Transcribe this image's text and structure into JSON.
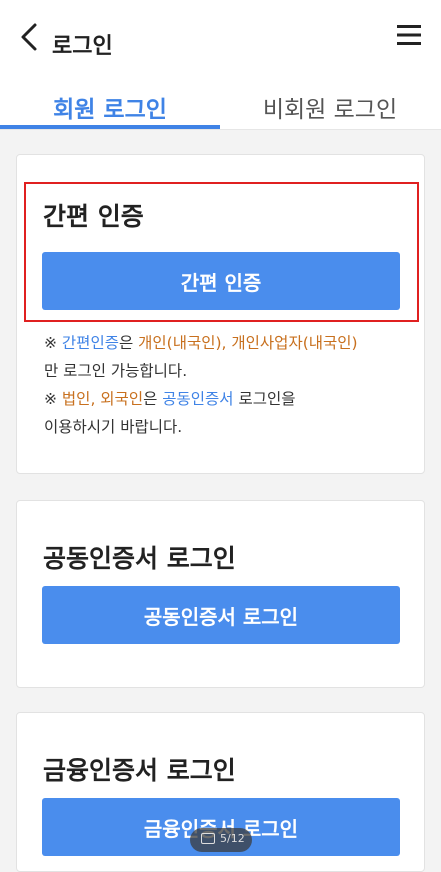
{
  "header": {
    "title": "로그인"
  },
  "tabs": [
    {
      "label": "회원 로그인"
    },
    {
      "label": "비회원 로그인"
    }
  ],
  "simple_auth": {
    "title": "간편 인증",
    "button": "간편 인증",
    "notice": {
      "mark1": "※ ",
      "simple": "간편인증",
      "eun": "은 ",
      "individuals": "개인(내국인), 개인사업자(내국인)",
      "rest1": "만 로그인 가능합니다.",
      "mark2": "※ ",
      "corp": "법인, 외국인",
      "eun2": "은 ",
      "joint": "공동인증서",
      "rest2": " 로그인을",
      "rest3": "이용하시기 바랍니다."
    }
  },
  "joint_cert": {
    "title": "공동인증서 로그인",
    "button": "공동인증서 로그인"
  },
  "financial_cert": {
    "title": "금융인증서 로그인",
    "button": "금융인증서 로그인"
  },
  "pager": {
    "text": "5/12"
  },
  "colors": {
    "accent": "#3f83e6",
    "button": "#4a8ded",
    "highlight": "#e02020",
    "orange": "#c8701e"
  }
}
